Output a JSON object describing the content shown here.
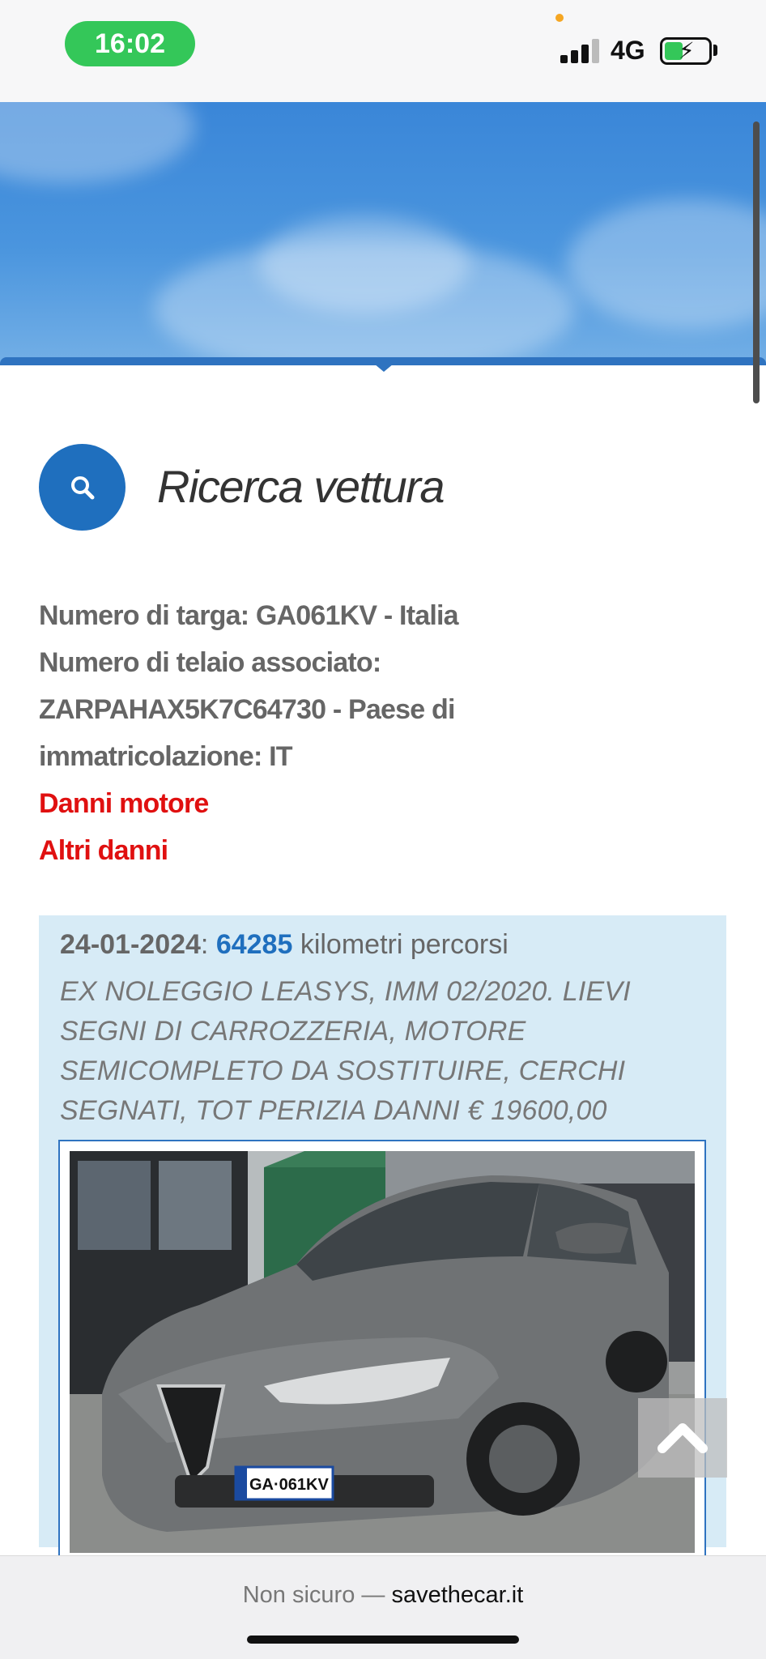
{
  "status_bar": {
    "time": "16:02",
    "network": "4G",
    "battery_state": "charging",
    "colors": {
      "time_pill": "#34c759",
      "battery_fill": "#34c759"
    }
  },
  "header": {
    "section_title": "Ricerca vettura",
    "icon": "search-icon"
  },
  "vehicle_info": {
    "plate_line": "Numero di targa: GA061KV - Italia",
    "vin_line": "Numero di telaio associato: ZARPAHAX5K7C64730 - Paese di immatricolazione: IT",
    "damage_links": [
      "Danni motore",
      "Altri danni"
    ]
  },
  "record": {
    "date": "24-01-2024",
    "separator": ": ",
    "km_value": "64285",
    "km_label": " kilometri percorsi",
    "description": "EX NOLEGGIO LEASYS, IMM 02/2020. LIEVI SEGNI DI CARROZZERIA, MOTORE SEMICOMPLETO DA SOSTITUIRE, CERCHI SEGNATI, TOT PERIZIA DANNI € 19600,00",
    "photo_plate_text": "GA·061KV"
  },
  "browser": {
    "not_secure_label": "Non sicuro —",
    "domain": "savethecar.it"
  },
  "colors": {
    "accent_blue": "#1f6fbe",
    "danger_red": "#e01010",
    "card_bg": "#d7ebf6"
  }
}
